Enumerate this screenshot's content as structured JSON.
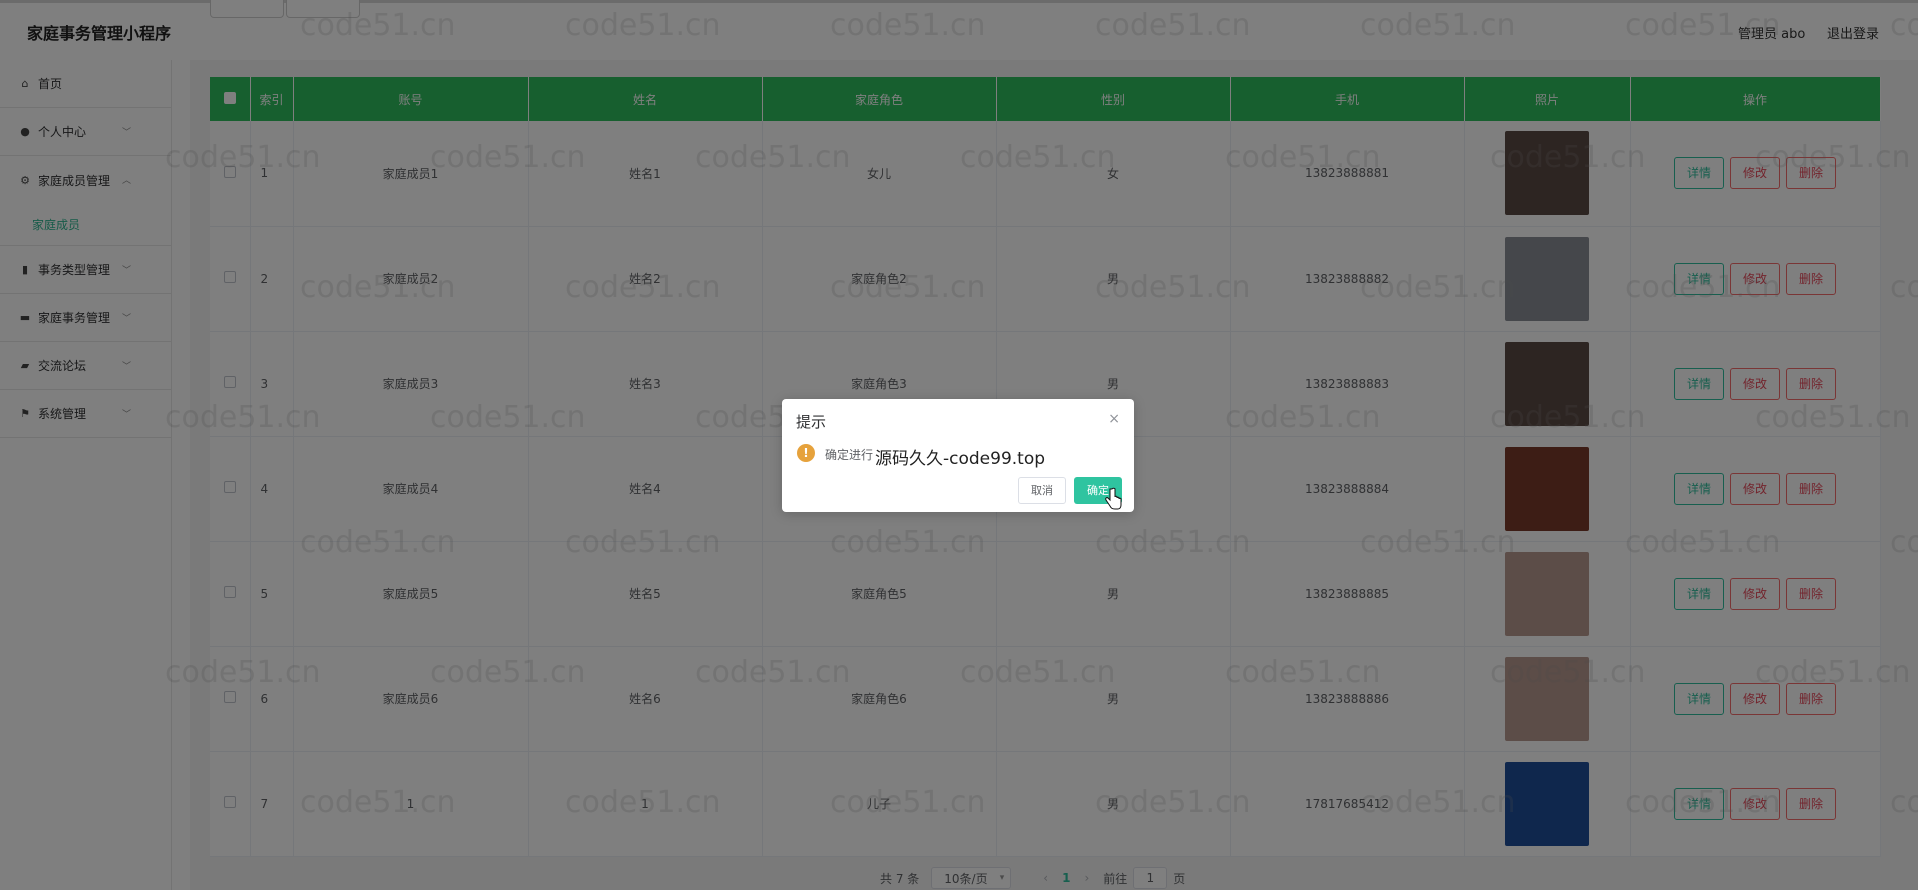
{
  "header": {
    "title": "家庭事务管理小程序",
    "admin": "管理员 abo",
    "logout": "退出登录"
  },
  "sidebar": {
    "items": [
      {
        "label": "首页",
        "icon": "home-icon",
        "glyph": "⌂"
      },
      {
        "label": "个人中心",
        "icon": "user-icon",
        "glyph": "●"
      },
      {
        "label": "家庭成员管理",
        "icon": "gear-icon",
        "glyph": "⚙"
      },
      {
        "label": "事务类型管理",
        "icon": "clipboard-icon",
        "glyph": "▮"
      },
      {
        "label": "家庭事务管理",
        "icon": "briefcase-icon",
        "glyph": "▬"
      },
      {
        "label": "交流论坛",
        "icon": "chat-icon",
        "glyph": "▰"
      },
      {
        "label": "系统管理",
        "icon": "flag-icon",
        "glyph": "⚑"
      }
    ],
    "active_sub": "家庭成员"
  },
  "table": {
    "headers": [
      "索引",
      "账号",
      "姓名",
      "家庭角色",
      "性别",
      "手机",
      "照片",
      "操作"
    ],
    "rows": [
      {
        "index": "1",
        "account": "家庭成员1",
        "name": "姓名1",
        "role": "女儿",
        "gender": "女",
        "phone": "13823888881",
        "photo_color": "#5a4a44"
      },
      {
        "index": "2",
        "account": "家庭成员2",
        "name": "姓名2",
        "role": "家庭角色2",
        "gender": "男",
        "phone": "13823888882",
        "photo_color": "#8a8e96"
      },
      {
        "index": "3",
        "account": "家庭成员3",
        "name": "姓名3",
        "role": "家庭角色3",
        "gender": "男",
        "phone": "13823888883",
        "photo_color": "#5a4a44"
      },
      {
        "index": "4",
        "account": "家庭成员4",
        "name": "姓名4",
        "role": "",
        "gender": "",
        "phone": "13823888884",
        "photo_color": "#7a3a2a"
      },
      {
        "index": "5",
        "account": "家庭成员5",
        "name": "姓名5",
        "role": "家庭角色5",
        "gender": "男",
        "phone": "13823888885",
        "photo_color": "#b89a90"
      },
      {
        "index": "6",
        "account": "家庭成员6",
        "name": "姓名6",
        "role": "家庭角色6",
        "gender": "男",
        "phone": "13823888886",
        "photo_color": "#b89a90"
      },
      {
        "index": "7",
        "account": "1",
        "name": "1",
        "role": "儿子",
        "gender": "男",
        "phone": "17817685412",
        "photo_color": "#1f4f9a"
      }
    ],
    "actions": {
      "detail": "详情",
      "edit": "修改",
      "delete": "删除"
    }
  },
  "pagination": {
    "total": "共 7 条",
    "page_size": "10条/页",
    "prev": "‹",
    "current": "1",
    "next": "›",
    "goto": "前往",
    "goto_value": "1",
    "page_unit": "页"
  },
  "dialog": {
    "title": "提示",
    "close": "×",
    "warn_glyph": "!",
    "message": "确定进行",
    "overlay_text": "源码久久-code99.top",
    "cancel": "取消",
    "ok": "确定"
  },
  "watermark": "code51.cn",
  "colors": {
    "accent": "#2fbf9e",
    "header_green": "#2fbf5e",
    "danger": "#f56c6c"
  }
}
